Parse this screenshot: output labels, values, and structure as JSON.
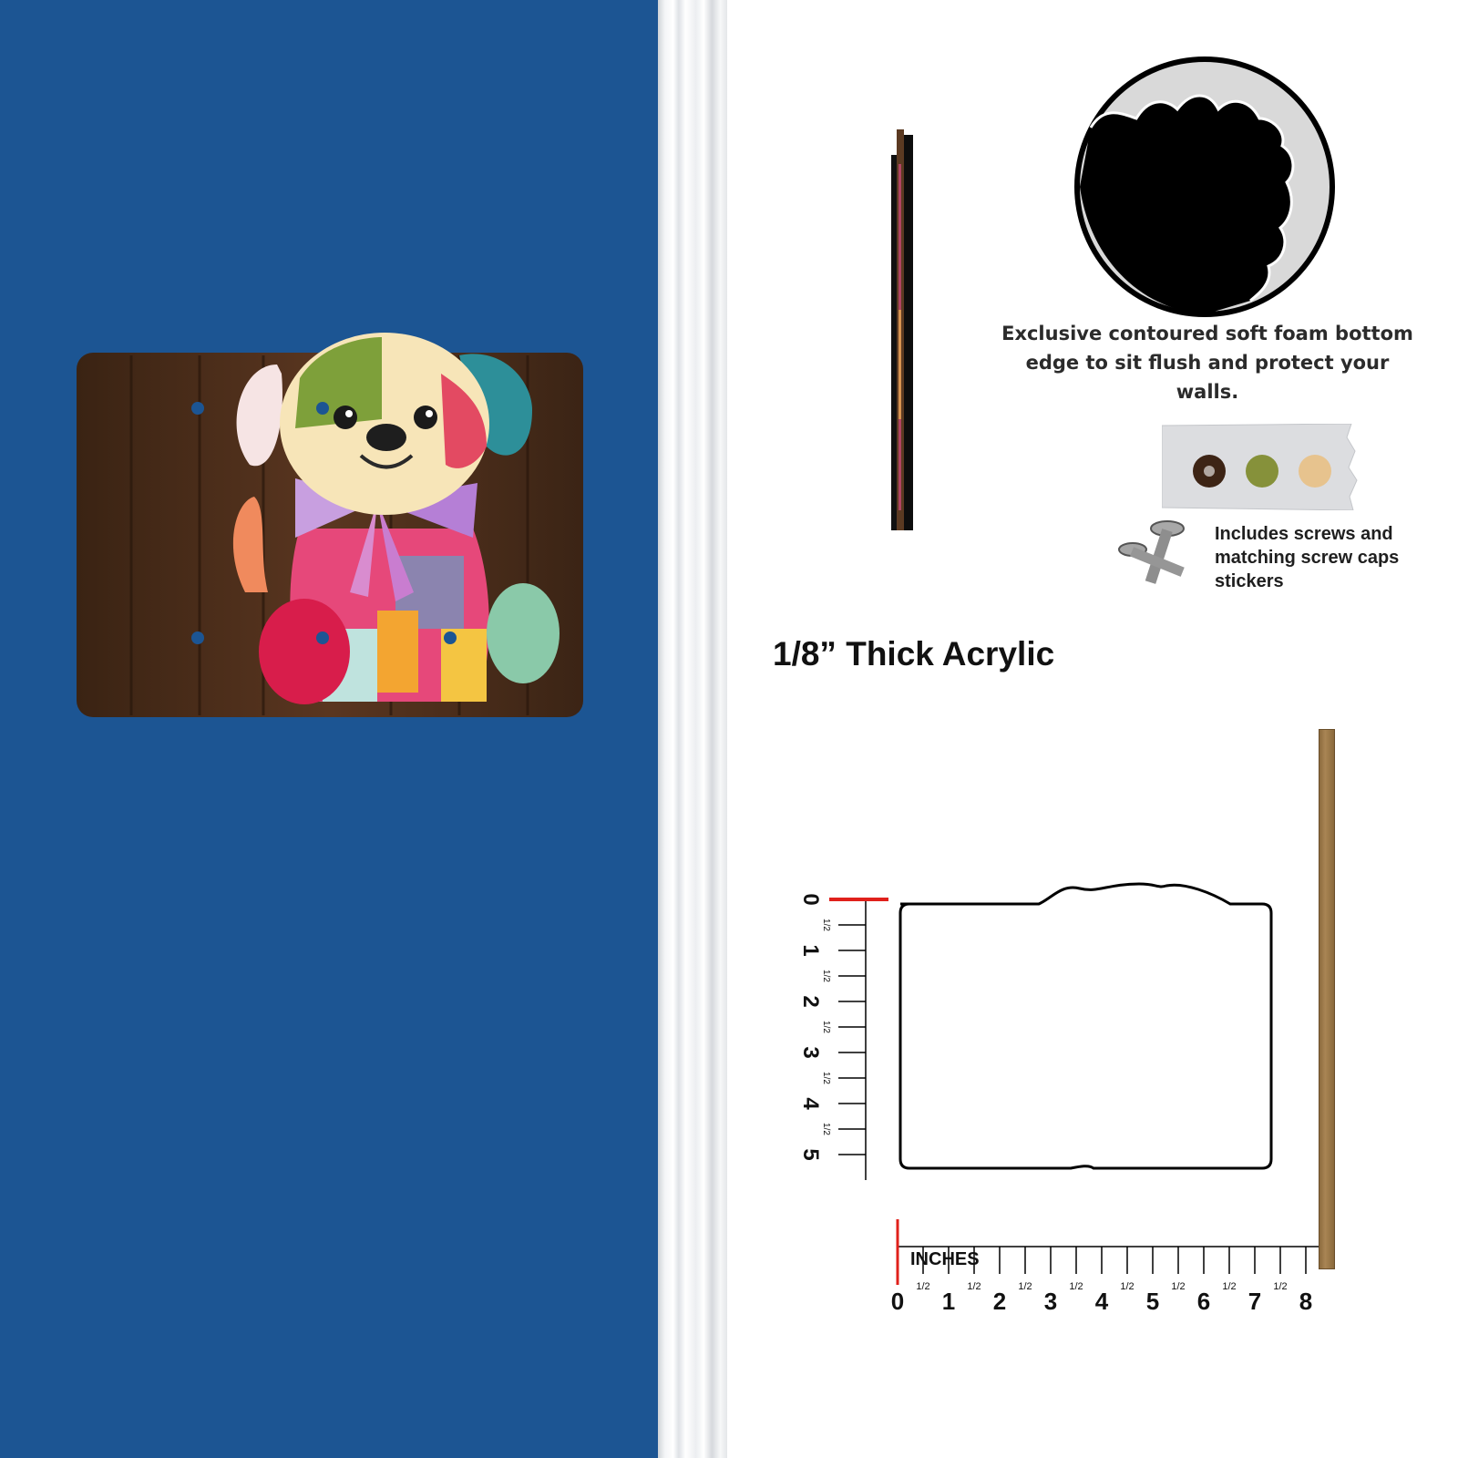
{
  "product": {
    "thickness_label": "1/8” Thick Acrylic",
    "foam_text": "Exclusive contoured soft foam bottom edge to sit flush and protect your walls.",
    "screws_text": "Includes screws and matching screw caps stickers",
    "units_label": "INCHES",
    "horizontal_ruler_labels": [
      "0",
      "1",
      "2",
      "3",
      "4",
      "5",
      "6",
      "7",
      "8"
    ],
    "vertical_ruler_labels": [
      "0",
      "1",
      "2",
      "3",
      "4",
      "5"
    ],
    "half_label": "1/2"
  },
  "colors": {
    "wall": "#1c5593",
    "ruler_zero_mark": "#e0201b",
    "acrylic_edge": "#9b7a4b"
  },
  "icons": {
    "sign": "patchwork-puppy-sign-image",
    "screws": "screws-icon",
    "foam": "foam-edge-closeup-icon",
    "caps": "screw-caps-sticker-icon"
  }
}
